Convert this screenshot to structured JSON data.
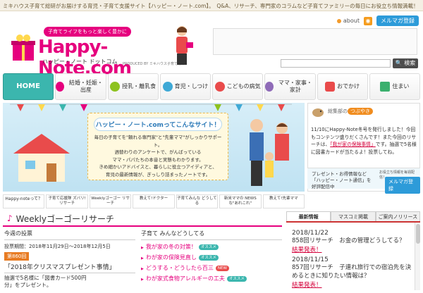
{
  "topbar": {
    "text": "ミキハウス子育て総研がお届けする育児・子育て支援サイト【ハッピー・ノート.com】。　Q&A、リサーチ、専門家のコラムなど子育てファミリーの毎日にお役立ち情報満載！"
  },
  "header": {
    "about_label": "about",
    "mailmag_label": "メルマガ登録",
    "tagline": "子育てライフをもっと楽しく豊かに",
    "logo": "Happy-Note.com",
    "logo_sub": "ハッピー・ノート ドットコム",
    "produced": "PRODUCED BY ミキハウス子育て総研",
    "search_placeholder": "",
    "search_button": "検索"
  },
  "nav": [
    {
      "label": "HOME",
      "color": "#3bb6ae"
    },
    {
      "label": "結婚・妊娠・出産",
      "color": "#e6007e"
    },
    {
      "label": "授乳・離乳食",
      "color": "#8dc21f"
    },
    {
      "label": "育児・しつけ",
      "color": "#3fa9d6"
    },
    {
      "label": "こどもの病気",
      "color": "#e94b4b"
    },
    {
      "label": "ママ・家事・家計",
      "color": "#8f6bb8"
    },
    {
      "label": "おでかけ",
      "color": "#e94b4b"
    },
    {
      "label": "住まい",
      "color": "#3bb06e"
    }
  ],
  "hero": {
    "title": "ハッピー・ノート.comってこんなサイト！",
    "lines": [
      "毎日の子育てを\"頼れる専門家\"と\"先輩ママ\"がしっかりサポート。",
      "週替わりのアンケートで、がんばっている",
      "ママ・パパたちの本音と実態もわかります。",
      "きめ細かいアドバイスと、暮らしに役立つアイディアと、",
      "育児の最新情報が、ぎっしり詰まったノートです。"
    ]
  },
  "sidebar": {
    "label": "総集部の",
    "tsubuyaki": "つぶやき",
    "text_before": "11/10にHappy-Note冬号を発行しました！今回もコンテンツ盛りだくさんです！また今回のリサーチは、",
    "link": "「我が家の保険事情」",
    "text_after": "です。抽選で5名様に図書カードが当たるよ！投票してね。",
    "promo_line1": "プレゼント・お得情報など",
    "promo_line2": "「ハッピー・ノート通信」を",
    "promo_line3": "好評配信中",
    "promo_note": "お役立ち情報を毎週配信！",
    "promo_button": "メルマガ登録"
  },
  "thumbs": [
    "Happy-noteって？",
    "子育て応援隊 ズバリ!リサーチ",
    "Weeklyゴーゴー リサーチ",
    "教えて!ドクター",
    "子育てみんな どうしてる",
    "新米ママの NEWSな\"あれこれ\"",
    "教えて!先輩ママ"
  ],
  "weekly": {
    "title": "Weeklyゴーゴーリサーチ",
    "col1_head": "今週の投票",
    "period": "投票期間：2018年11月29日～2018年12月5日",
    "badge": "第860回",
    "question": "「2018年クリスマスプレゼント事情」",
    "prize_line1": "抽選で5名様に「図書カード500円",
    "prize_line2": "分」をプレゼント。",
    "col2_head": "子育て みんなどうしてる",
    "items": [
      {
        "text": "我が家の冬の対策！",
        "tag": "オススメ",
        "new": false
      },
      {
        "text": "わが家の保険見直し",
        "tag": "オススメ",
        "new": false
      },
      {
        "text": "どうする・どうしたら百三",
        "tag": "NEW",
        "new": true
      },
      {
        "text": "わが家式食物アレルギーの工夫",
        "tag": "オススメ",
        "new": false
      }
    ]
  },
  "right": {
    "tabs": [
      "最新情報",
      "マスコミ掲載",
      "ご案内ノリリース"
    ],
    "news": [
      {
        "date": "2018/11/22",
        "text": "858回リサーチ　お金の管理どうしてる？",
        "link": "結果発表！"
      },
      {
        "date": "2018/11/15",
        "text": "857回リサーチ　子連れ旅行での宿泊先を決めるときに知りたい情報は？",
        "link": "結果発表！"
      }
    ]
  }
}
